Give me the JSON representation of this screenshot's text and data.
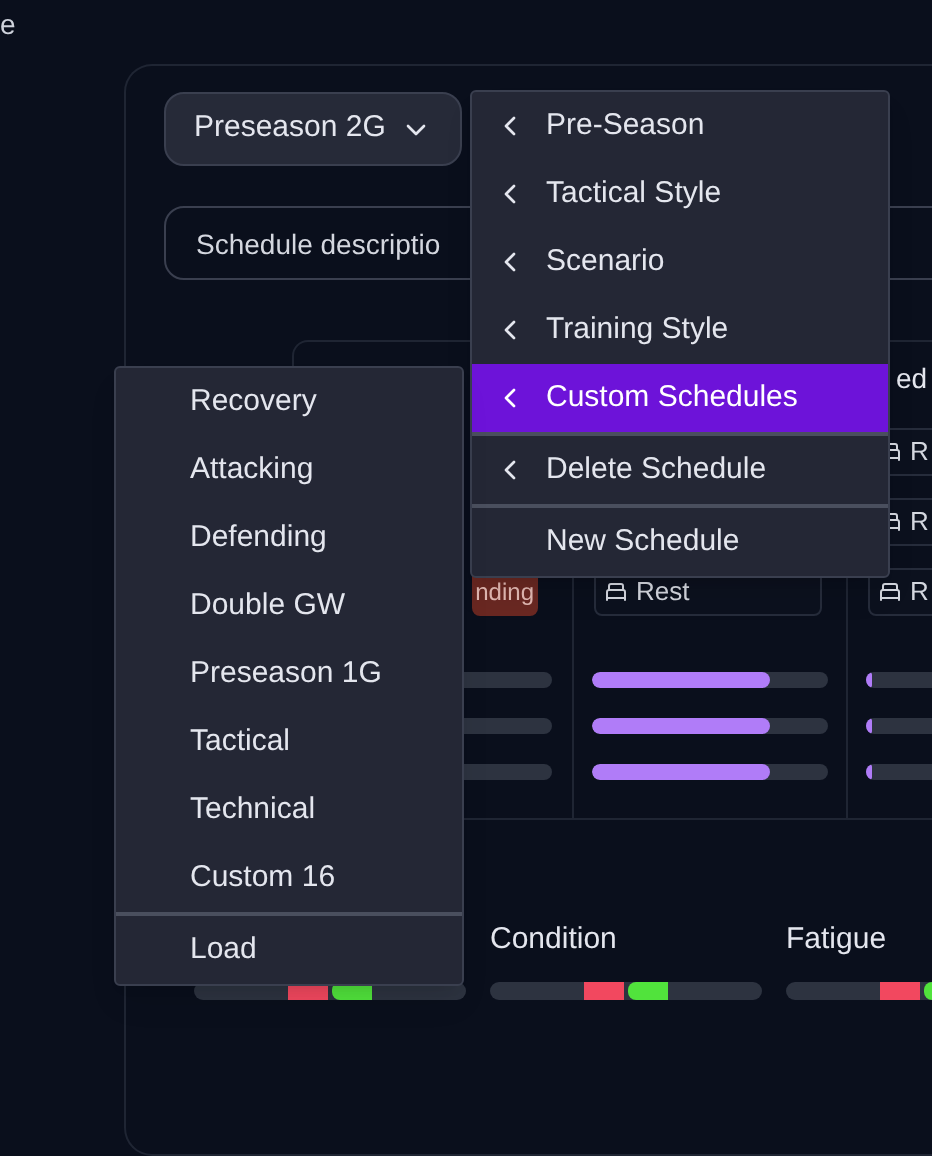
{
  "corner_text": "e",
  "preset_dropdown": {
    "value": "Preseason 2G"
  },
  "description_field": {
    "placeholder": "Schedule descriptio"
  },
  "day_columns": [
    {
      "chips": [
        {
          "kind": "tag",
          "label": "nding"
        }
      ]
    },
    {
      "chips": [
        {
          "kind": "rest",
          "label": "Rest"
        }
      ],
      "bars": [
        {
          "level": 0.75
        },
        {
          "level": 0.75
        },
        {
          "level": 0.75
        }
      ]
    },
    {
      "header": "ed",
      "chips": [
        {
          "kind": "rest",
          "label": "R"
        },
        {
          "kind": "rest",
          "label": "R"
        },
        {
          "kind": "rest",
          "label": "R"
        }
      ],
      "bars": [
        {
          "level": 0.02
        },
        {
          "level": 0.02
        },
        {
          "level": 0.02
        }
      ]
    }
  ],
  "stats": [
    {
      "kind": "meter"
    },
    {
      "kind": "meter",
      "label": "Condition"
    },
    {
      "kind": "meter",
      "label": "Fatigue"
    }
  ],
  "schedule_menu": [
    {
      "label": "Pre-Season",
      "submenu": true,
      "selected": false,
      "separator_before": false
    },
    {
      "label": "Tactical Style",
      "submenu": true,
      "selected": false,
      "separator_before": false
    },
    {
      "label": "Scenario",
      "submenu": true,
      "selected": false,
      "separator_before": false
    },
    {
      "label": "Training Style",
      "submenu": true,
      "selected": false,
      "separator_before": false
    },
    {
      "label": "Custom Schedules",
      "submenu": true,
      "selected": true,
      "separator_before": false
    },
    {
      "label": "Delete Schedule",
      "submenu": true,
      "selected": false,
      "separator_before": true
    },
    {
      "label": "New Schedule",
      "submenu": false,
      "selected": false,
      "separator_before": true
    }
  ],
  "custom_schedules_menu": [
    {
      "label": "Recovery",
      "separator_before": false
    },
    {
      "label": "Attacking",
      "separator_before": false
    },
    {
      "label": "Defending",
      "separator_before": false
    },
    {
      "label": "Double GW",
      "separator_before": false
    },
    {
      "label": "Preseason 1G",
      "separator_before": false
    },
    {
      "label": "Tactical",
      "separator_before": false
    },
    {
      "label": "Technical",
      "separator_before": false
    },
    {
      "label": "Custom 16",
      "separator_before": false
    },
    {
      "label": "Load",
      "separator_before": true
    }
  ]
}
